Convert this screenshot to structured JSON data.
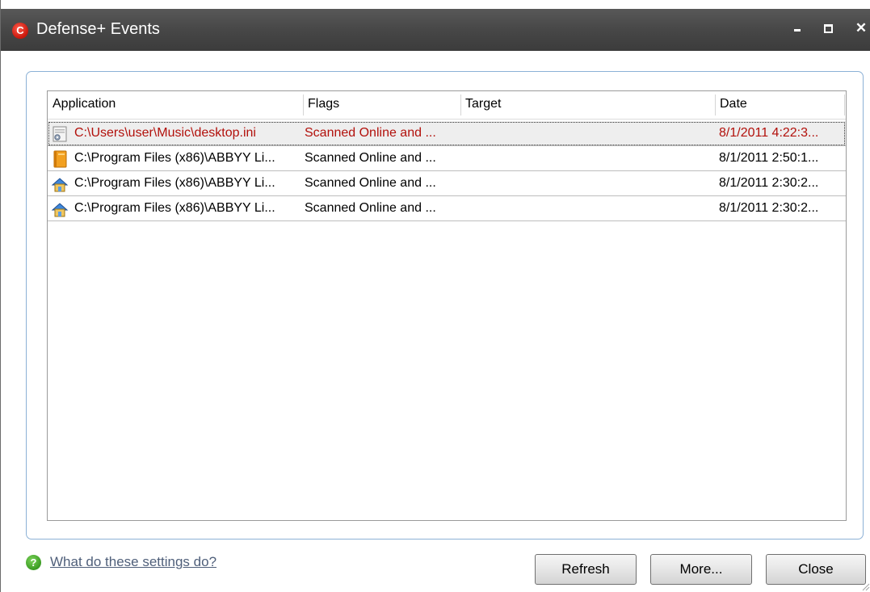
{
  "window": {
    "title": "Defense+ Events"
  },
  "list": {
    "columns": [
      "Application",
      "Flags",
      "Target",
      "Date"
    ],
    "rows": [
      {
        "icon": "ini-file-icon",
        "application": "C:\\Users\\user\\Music\\desktop.ini",
        "flags": "Scanned Online and ...",
        "target": "",
        "date": "8/1/2011 4:22:3...",
        "selected": true
      },
      {
        "icon": "book-icon",
        "application": "C:\\Program Files (x86)\\ABBYY Li...",
        "flags": "Scanned Online and ...",
        "target": "",
        "date": "8/1/2011 2:50:1...",
        "selected": false
      },
      {
        "icon": "installer-icon",
        "application": "C:\\Program Files (x86)\\ABBYY Li...",
        "flags": "Scanned Online and ...",
        "target": "",
        "date": "8/1/2011 2:30:2...",
        "selected": false
      },
      {
        "icon": "installer-icon",
        "application": "C:\\Program Files (x86)\\ABBYY Li...",
        "flags": "Scanned Online and ...",
        "target": "",
        "date": "8/1/2011 2:30:2...",
        "selected": false
      }
    ]
  },
  "footer": {
    "help_text": "What do these settings do?",
    "refresh_label": "Refresh",
    "more_label": "More...",
    "close_label": "Close"
  },
  "colors": {
    "titlebar": "#474747",
    "selected_text": "#b2100b",
    "group_border": "#8cb1d6"
  }
}
